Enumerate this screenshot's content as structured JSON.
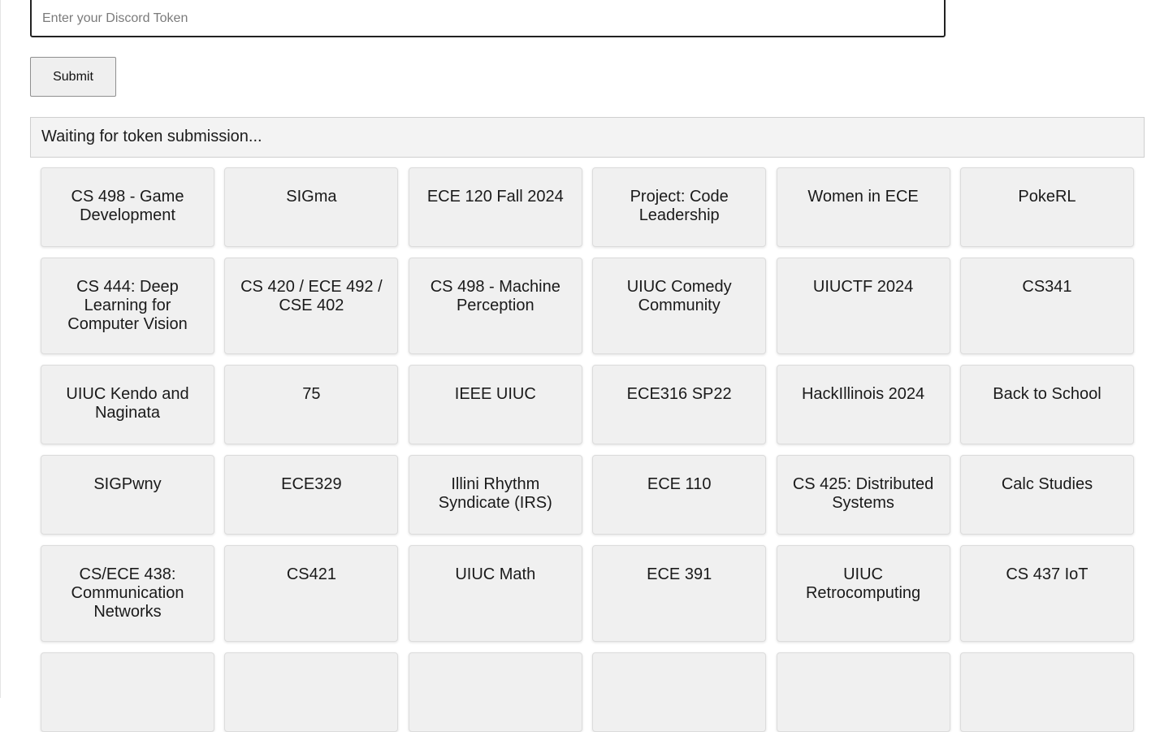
{
  "token_form": {
    "placeholder": "Enter your Discord Token",
    "value": "",
    "submit_label": "Submit"
  },
  "status": {
    "text": "Waiting for token submission..."
  },
  "servers": [
    {
      "name": "CS 498 - Game Development"
    },
    {
      "name": "SIGma"
    },
    {
      "name": "ECE 120 Fall 2024"
    },
    {
      "name": "Project: Code Leadership"
    },
    {
      "name": "Women in ECE"
    },
    {
      "name": "PokeRL"
    },
    {
      "name": "CS 444: Deep Learning for Computer Vision"
    },
    {
      "name": "CS 420 / ECE 492 / CSE 402"
    },
    {
      "name": "CS 498 - Machine Perception"
    },
    {
      "name": "UIUC Comedy Community"
    },
    {
      "name": "UIUCTF 2024"
    },
    {
      "name": "CS341"
    },
    {
      "name": "UIUC Kendo and Naginata"
    },
    {
      "name": "75"
    },
    {
      "name": "IEEE UIUC"
    },
    {
      "name": "ECE316 SP22"
    },
    {
      "name": "HackIllinois 2024"
    },
    {
      "name": "Back to School"
    },
    {
      "name": "SIGPwny"
    },
    {
      "name": "ECE329"
    },
    {
      "name": "Illini Rhythm Syndicate (IRS)"
    },
    {
      "name": "ECE 110"
    },
    {
      "name": "CS 425: Distributed Systems"
    },
    {
      "name": "Calc Studies"
    },
    {
      "name": "CS/ECE 438: Communication Networks"
    },
    {
      "name": "CS421"
    },
    {
      "name": "UIUC Math"
    },
    {
      "name": "ECE 391"
    },
    {
      "name": "UIUC Retrocomputing"
    },
    {
      "name": "CS 437 IoT"
    },
    {
      "name": ""
    },
    {
      "name": ""
    },
    {
      "name": ""
    },
    {
      "name": ""
    },
    {
      "name": ""
    },
    {
      "name": ""
    }
  ]
}
